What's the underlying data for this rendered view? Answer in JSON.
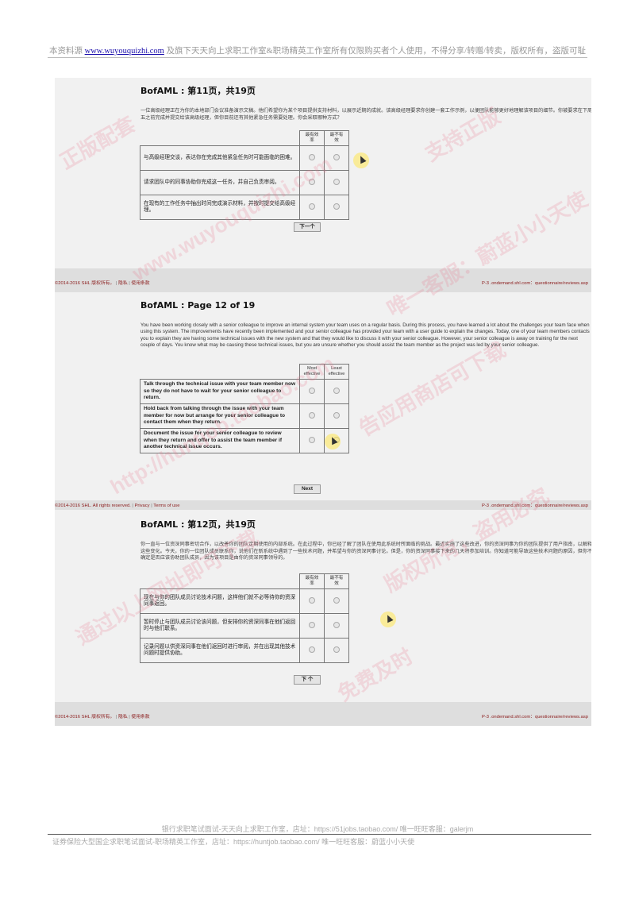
{
  "header": {
    "prefix": "本资料源",
    "link": "www.wuyouquizhi.com",
    "suffix": "及旗下天天向上求职工作室&职场精英工作室所有仅限购买者个人使用，不得分享/转赠/转卖，版权所有，盗版可耻"
  },
  "page1": {
    "title": "BofAML : 第11页，共19页",
    "intro": "一位高级经理正在为你的本地部门会议准备演示文稿。他们希望你为某个项目提供支持材料，以展示近期的成就。该高级经理要求你创建一套工作示例，以便团队能够更好地理解该项目的细节。你被要求在下周五之前完成并提交给该高级经理，但你目前还有其他紧急任务需要处理。你会采取哪种方式？",
    "col_most": "最有效率",
    "col_least": "最不有效",
    "rows": [
      "与高级经理交谈，表达你在完成其他紧急任务时可能面临的困难。",
      "请求团队中的同事协助你完成这一任务，并自己负责审阅。",
      "在现有的工作任务中抽出时间完成演示材料，并按时提交给高级经理。"
    ],
    "next": "下一个",
    "footer_copy": "©2014-2016 SHL  版权所有。",
    "footer_privacy": "隐私",
    "footer_terms": "使用条款",
    "footer_url": "P-3 .ondemand.shl.com：questionnaire/reviews.asp"
  },
  "page2": {
    "title": "BofAML : Page 12 of 19",
    "intro": "You have been working closely with a senior colleague to improve an internal system your team uses on a regular basis. During this process, you have learned a lot about the challenges your team face when using this system. The improvements have recently been implemented and your senior colleague has provided your team with a user guide to explain the changes. Today, one of your team members contacts you to explain they are having some technical issues with the new system and that they would like to discuss it with your senior colleague. However, your senior colleague is away on training for the next couple of days. You know what may be causing these technical issues, but you are unsure whether you should assist the team member as the project was led by your senior colleague.",
    "col_most": "Most effective",
    "col_least": "Least effective",
    "rows": [
      "Talk through the technical issue with your team member now so they do not have to wait for your senior colleague to return.",
      "Hold back from talking through the issue with your team member for now but arrange for your senior colleague to contact them when they return.",
      "Document the issue for your senior colleague to review when they return and offer to assist the team member if another technical issue occurs."
    ],
    "next": "Next",
    "footer_copy": "©2014-2016 SHL. All rights reserved.",
    "footer_privacy": "Privacy",
    "footer_terms": "Terms of use",
    "footer_url": "P-3 .ondemand.shl.com：questionnaire/reviews.asp"
  },
  "page3": {
    "title": "BofAML : 第12页，共19页",
    "intro": "你一直与一位资深同事密切合作，以改善你的团队定期使用的内部系统。在此过程中，你已经了解了团队在使用此系统时所面临的挑战。最近实施了这些改进，你的资深同事为你的团队提供了用户指南，以解释这些变化。今天，你的一位团队成员联系你，说他们在新系统中遇到了一些技术问题，并希望与你的资深同事讨论。但是，你的资深同事接下来的几天将参加培训。你知道可能导致这些技术问题的原因，但你不确定是否应该协助团队成员，因为该项目是由你的资深同事领导的。",
    "col_most": "最有效率",
    "col_least": "最不有效",
    "rows": [
      "现在与你的团队成员讨论技术问题，这样他们就不必等待你的资深同事返回。",
      "暂时停止与团队成员讨论该问题，但安排你的资深同事在他们返回时与他们联系。",
      "记录问题以供资深同事在他们返回时进行审阅，并在出现其他技术问题时提供协助。"
    ],
    "next": "下 个",
    "footer_copy": "©2014-2016 SHL  版权所有。",
    "footer_privacy": "隐私",
    "footer_terms": "使用条款",
    "footer_url": "P-3 .ondemand.shl.com：questionnaire/reviews.asp"
  },
  "watermarks": [
    "正版配套",
    "www.wuyouquizhi.com",
    "http://huntjob.taobao.com",
    "通过以上网址即可下载",
    "版权所有，盗用必究",
    "唯一客服：蔚蓝小小天使",
    "告应用商店可下载",
    "支持正版",
    "免费及时"
  ],
  "footer": {
    "line1": "银行求职笔试面试-天天向上求职工作室，店址：https://51jobs.taobao.com/  唯一旺旺客服：galerjm",
    "line2": "证券保险大型国企求职笔试面试-职场精英工作室，店址：https://huntjob.taobao.com/  唯一旺旺客服：蔚蓝小小天使"
  }
}
